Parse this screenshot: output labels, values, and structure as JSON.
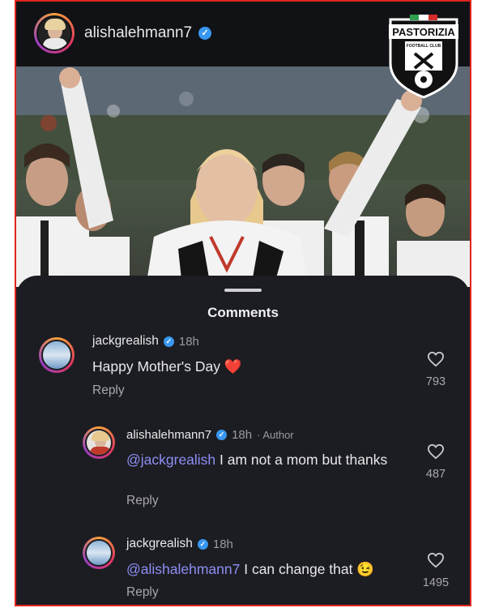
{
  "post": {
    "username": "alishalehmann7",
    "verified": true
  },
  "logo": {
    "top": "PASTORIZIA",
    "sub": "FOOTBALL CLUB"
  },
  "comments_sheet": {
    "title": "Comments"
  },
  "comments": [
    {
      "username": "jackgrealish",
      "time": "18h",
      "text": "Happy Mother's Day",
      "emoji": "❤️",
      "reply_label": "Reply",
      "likes": "793"
    },
    {
      "username": "alishalehmann7",
      "time": "18h",
      "author_tag": "· Author",
      "mention": "@jackgrealish",
      "text": " I am not a mom but thanks",
      "reply_label": "Reply",
      "likes": "487"
    },
    {
      "username": "jackgrealish",
      "time": "18h",
      "mention": "@alishalehmann7",
      "text": " I can change that",
      "emoji": "😉",
      "reply_label": "Reply",
      "likes": "1495"
    }
  ],
  "colors": {
    "frame_border": "#e0241b",
    "sheet_bg": "#1c1d22",
    "mention": "#8e8ef5",
    "verified": "#3897f0"
  },
  "icons": [
    "verified-badge-icon",
    "heart-icon",
    "red-heart-emoji",
    "wink-emoji"
  ]
}
